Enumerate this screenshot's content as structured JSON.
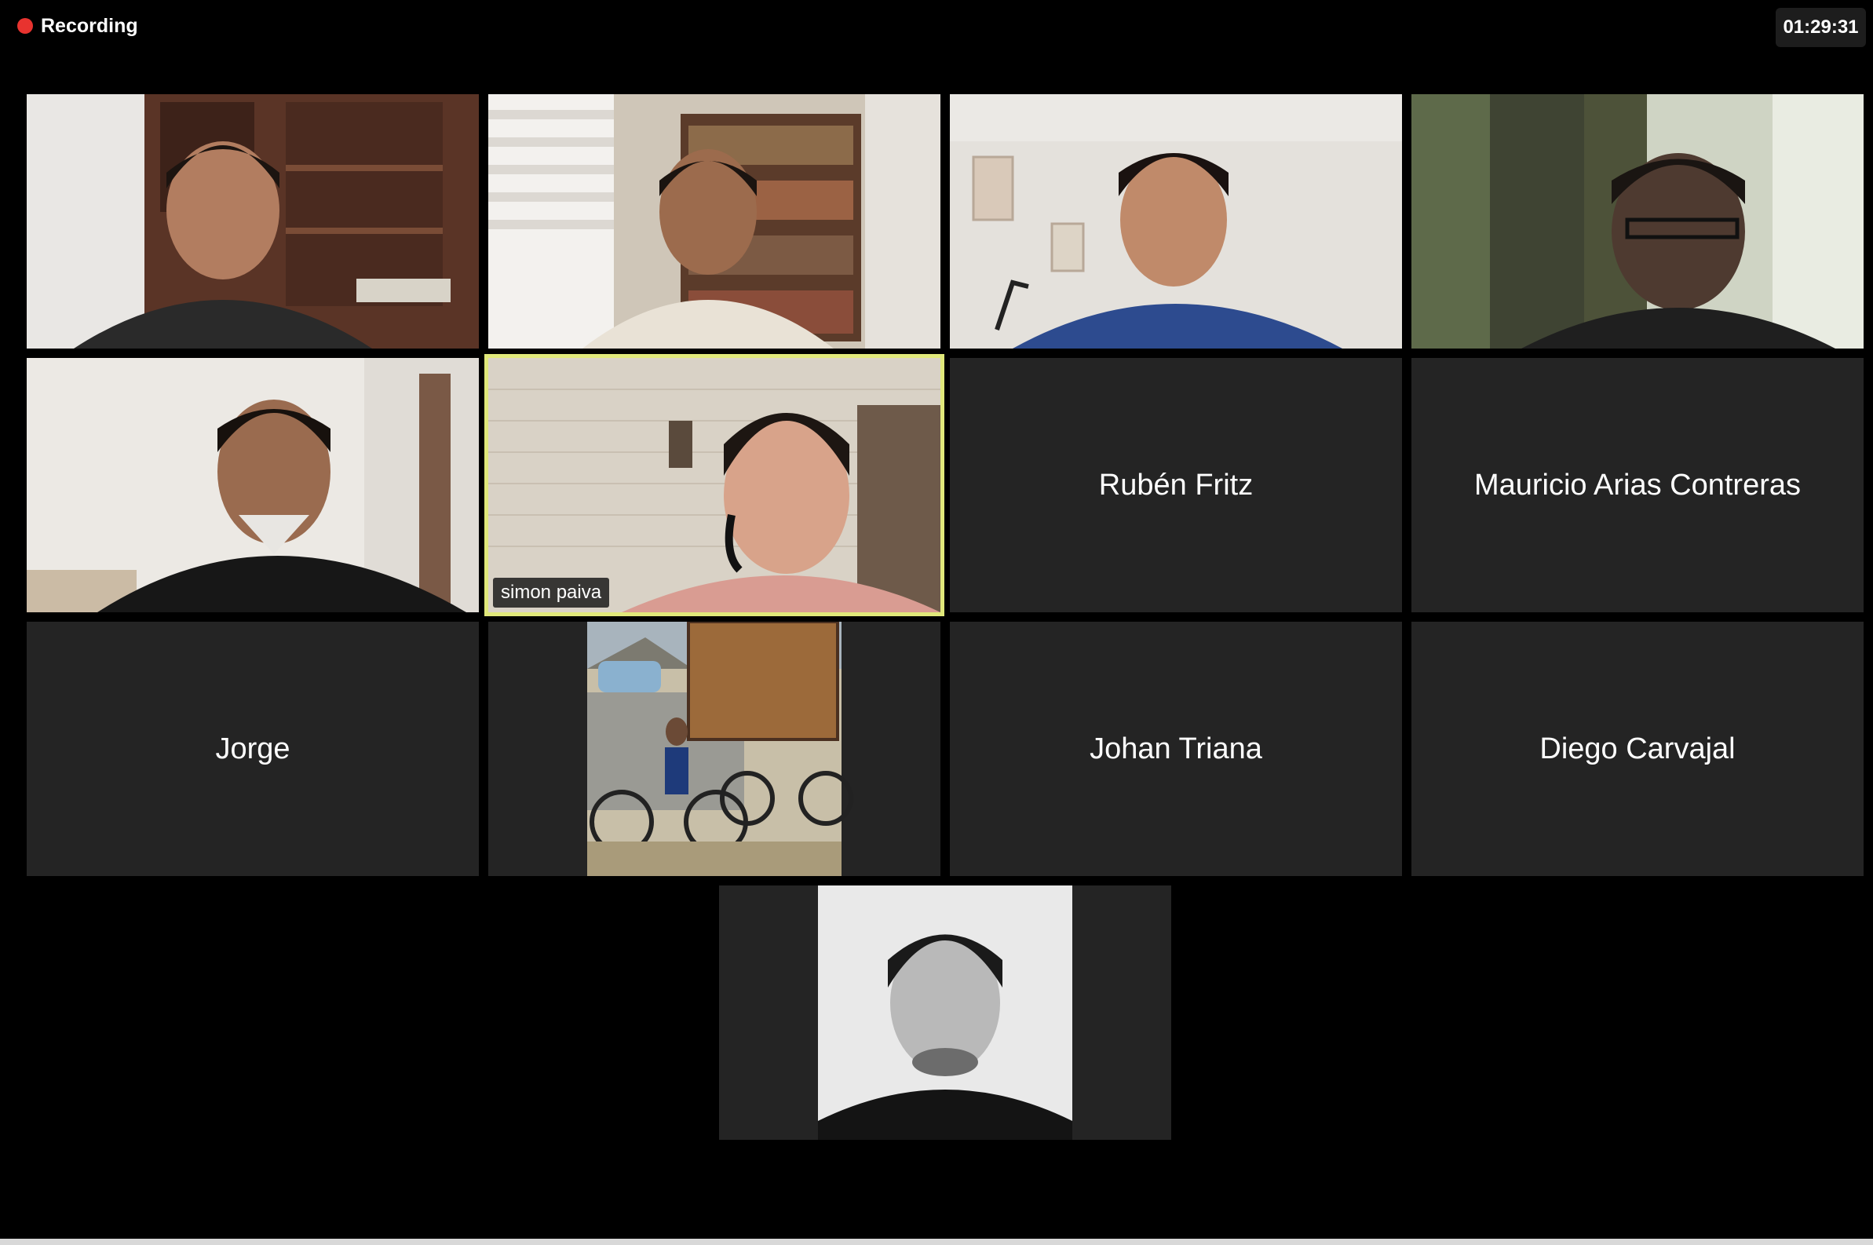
{
  "recording": {
    "label": "Recording",
    "dot_color": "#e8332f"
  },
  "timer": "01:29:31",
  "tiles": {
    "t1": {
      "type": "video",
      "icon": "participant-video"
    },
    "t2": {
      "type": "video",
      "icon": "participant-video"
    },
    "t3": {
      "type": "video",
      "icon": "participant-video"
    },
    "t4": {
      "type": "video",
      "icon": "participant-video"
    },
    "t5": {
      "type": "video",
      "icon": "participant-video"
    },
    "t6": {
      "type": "video",
      "name": "simon paiva",
      "active_speaker": true,
      "highlight_color": "#e0e87a"
    },
    "t7": {
      "type": "name",
      "name": "Rubén Fritz"
    },
    "t8": {
      "type": "name",
      "name": "Mauricio Arias Contreras"
    },
    "t9": {
      "type": "name",
      "name": "Jorge"
    },
    "t10": {
      "type": "profile-photo",
      "icon": "bicycle-photo"
    },
    "t11": {
      "type": "name",
      "name": "Johan Triana"
    },
    "t12": {
      "type": "name",
      "name": "Diego Carvajal"
    },
    "t13": {
      "type": "profile-photo",
      "icon": "portrait-photo"
    }
  },
  "colors": {
    "background": "#000000",
    "tile": "#242424",
    "active_border": "#e0e87a"
  }
}
